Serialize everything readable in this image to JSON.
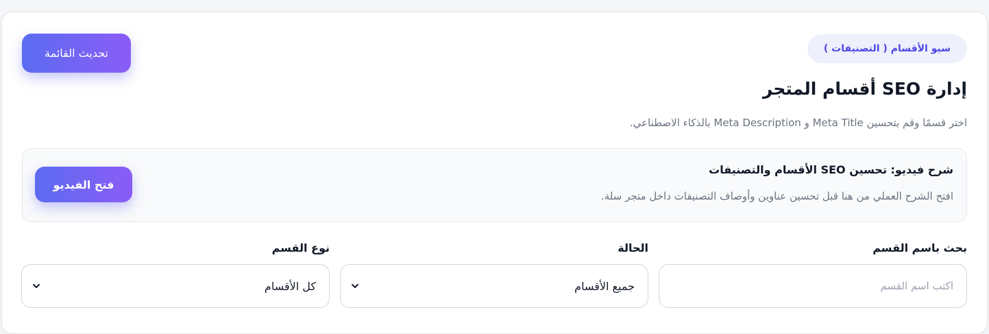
{
  "header": {
    "refresh_label": "تحديث القائمة",
    "badge": "سيو الأقسام ( التصنيفات )",
    "title": "إدارة SEO أقسام المتجر",
    "subtitle": "اختر قسمًا وقم بتحسين Meta Title و Meta Description بالذكاء الاصطناعي."
  },
  "video": {
    "title": "شرح فيديو: تحسين SEO الأقسام والتصنيفات",
    "description": "افتح الشرح العملي من هنا قبل تحسين عناوين وأوصاف التصنيفات داخل متجر سلة.",
    "button_label": "فتح الفيديو"
  },
  "filters": {
    "search": {
      "label": "بحث باسم القسم",
      "placeholder": "اكتب اسم القسم",
      "value": ""
    },
    "status": {
      "label": "الحالة",
      "selected": "جميع الأقسام"
    },
    "type": {
      "label": "نوع القسم",
      "selected": "كل الأقسام"
    }
  },
  "colors": {
    "accent_start": "#5b6cf0",
    "accent_end": "#8b5cf6",
    "badge_bg": "#eef0fc",
    "badge_text": "#4f46e5"
  },
  "icons": {
    "select_arrow": "chevron-down-icon"
  }
}
